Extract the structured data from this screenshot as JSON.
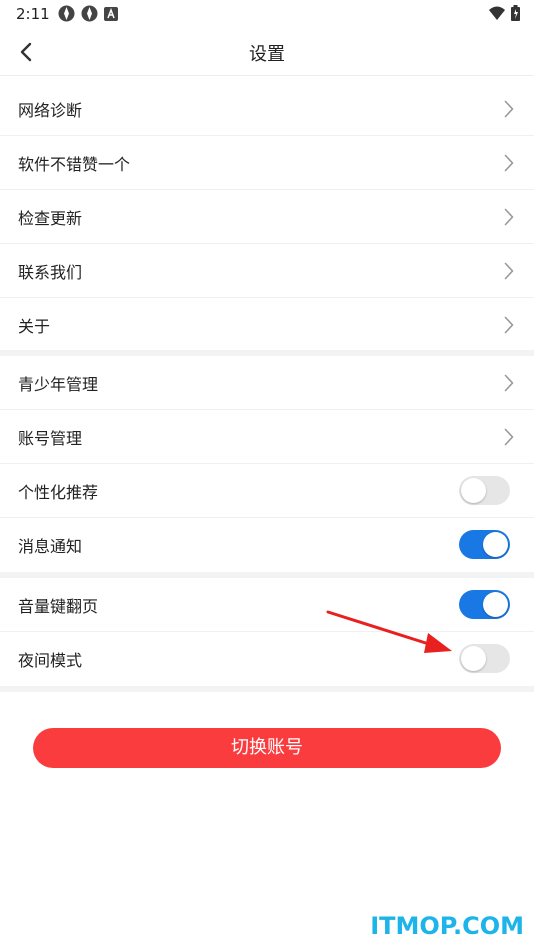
{
  "status_bar": {
    "time": "2:11",
    "icons_left": [
      "app-notification-icon",
      "app-notification-icon",
      "a-badge-icon"
    ],
    "icons_right": [
      "wifi-icon",
      "battery-icon"
    ]
  },
  "header": {
    "title": "设置",
    "back_icon": "chevron-left-icon"
  },
  "groups": [
    {
      "items": [
        {
          "label": "网络诊断",
          "control": "chevron"
        },
        {
          "label": "软件不错赞一个",
          "control": "chevron"
        },
        {
          "label": "检查更新",
          "control": "chevron"
        },
        {
          "label": "联系我们",
          "control": "chevron"
        },
        {
          "label": "关于",
          "control": "chevron"
        }
      ]
    },
    {
      "items": [
        {
          "label": "青少年管理",
          "control": "chevron"
        },
        {
          "label": "账号管理",
          "control": "chevron"
        },
        {
          "label": "个性化推荐",
          "control": "toggle",
          "on": false
        },
        {
          "label": "消息通知",
          "control": "toggle",
          "on": true
        }
      ]
    },
    {
      "items": [
        {
          "label": "音量键翻页",
          "control": "toggle",
          "on": true
        },
        {
          "label": "夜间模式",
          "control": "toggle",
          "on": false
        }
      ]
    }
  ],
  "switch_account_label": "切换账号",
  "watermark": "ITMOP.COM",
  "colors": {
    "accent_blue": "#1a78e4",
    "button_red": "#fb3c3f",
    "annotation_arrow": "#e8201f",
    "watermark": "#1db4ea"
  }
}
